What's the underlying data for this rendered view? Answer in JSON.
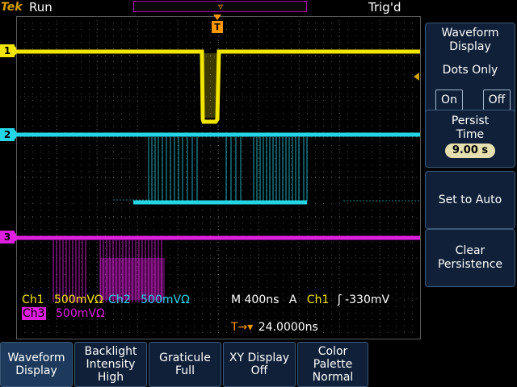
{
  "status": {
    "brand": "Tek",
    "run_state": "Run",
    "trigger_state": "Trig'd"
  },
  "markers": {
    "ch1": "1",
    "ch2": "2",
    "ch3": "3",
    "trigger": "T"
  },
  "readouts": {
    "ch1_label": "Ch1",
    "ch1_scale": "500mV",
    "ch1_ohm": "Ω",
    "ch2_label": "Ch2",
    "ch2_scale": "500mV",
    "ch2_ohm": "Ω",
    "timebase": "M 400ns",
    "trigger_mode": "A",
    "trigger_source": "Ch1",
    "trigger_slope_icon": "rising-edge-icon",
    "trigger_level": "-330mV",
    "ch3_label": "Ch3",
    "ch3_scale": "500mV",
    "ch3_ohm": "Ω",
    "trigger_position_label": "T→▾",
    "trigger_position": "24.0000ns"
  },
  "side_menu": {
    "title_line1": "Waveform",
    "title_line2": "Display",
    "dots_only_label": "Dots Only",
    "dots_on": "On",
    "dots_off": "Off",
    "persist_line1": "Persist",
    "persist_line2": "Time",
    "persist_value": "9.00 s",
    "set_to_auto": "Set to Auto",
    "clear_line1": "Clear",
    "clear_line2": "Persistence"
  },
  "bottom_menu": [
    {
      "line1": "Waveform",
      "line2": "Display",
      "line3": ""
    },
    {
      "line1": "Backlight",
      "line2": "Intensity",
      "line3": "High"
    },
    {
      "line1": "Graticule",
      "line2": "Full",
      "line3": ""
    },
    {
      "line1": "XY Display",
      "line2": "Off",
      "line3": ""
    },
    {
      "line1": "Color",
      "line2": "Palette",
      "line3": "Normal"
    }
  ],
  "colors": {
    "ch1": "#f2e600",
    "ch2": "#22d6e6",
    "ch3": "#e01ee0",
    "trigger": "#ff9800",
    "menu_bg": "#0f2038"
  }
}
